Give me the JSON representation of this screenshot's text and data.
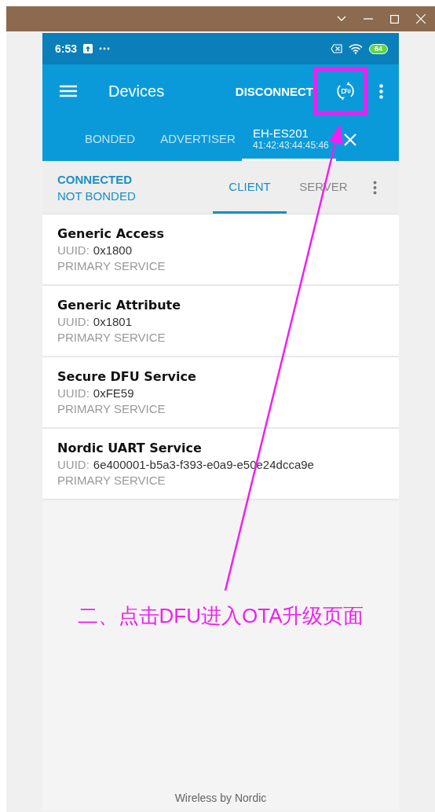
{
  "status_bar": {
    "time": "6:53",
    "battery": "64"
  },
  "toolbar": {
    "title": "Devices",
    "action": "DISCONNECT"
  },
  "tabs": [
    {
      "label": "BONDED",
      "selected": false
    },
    {
      "label": "ADVERTISER",
      "selected": false
    },
    {
      "label": "EH-ES201",
      "address": "41:42:43:44:45:46",
      "selected": true
    }
  ],
  "connection": {
    "state": "CONNECTED",
    "bond": "NOT BONDED"
  },
  "sub_tabs": [
    {
      "label": "CLIENT",
      "selected": true
    },
    {
      "label": "SERVER",
      "selected": false
    }
  ],
  "services": [
    {
      "name": "Generic Access",
      "uuid_label": "UUID:",
      "uuid": "0x1800",
      "type": "PRIMARY SERVICE"
    },
    {
      "name": "Generic Attribute",
      "uuid_label": "UUID:",
      "uuid": "0x1801",
      "type": "PRIMARY SERVICE"
    },
    {
      "name": "Secure DFU Service",
      "uuid_label": "UUID:",
      "uuid": "0xFE59",
      "type": "PRIMARY SERVICE"
    },
    {
      "name": "Nordic UART Service",
      "uuid_label": "UUID:",
      "uuid": "6e400001-b5a3-f393-e0a9-e50e24dcca9e",
      "type": "PRIMARY SERVICE"
    }
  ],
  "annotation": "二、点击DFU进入OTA升级页面",
  "footer": "Wireless by Nordic"
}
